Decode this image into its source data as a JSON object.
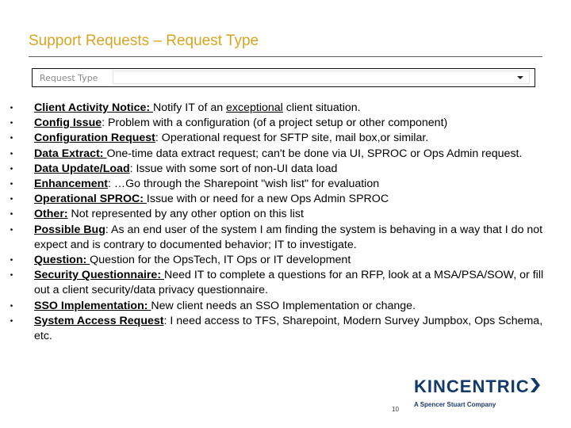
{
  "slide": {
    "title": "Support Requests – Request Type",
    "page_number": "10"
  },
  "request_type_field": {
    "label": "Request Type",
    "value": "",
    "icon": "caret-down-icon"
  },
  "bullet_glyph": "•",
  "items": [
    {
      "term": "Client Activity Notice: ",
      "parts": [
        {
          "text": "Notify IT of an ",
          "u": false
        },
        {
          "text": "exceptional",
          "u": true
        },
        {
          "text": " client situation.",
          "u": false
        }
      ]
    },
    {
      "term": "Config Issue",
      "parts": [
        {
          "text": ": Problem with a configuration (of a project setup or other component)",
          "u": false
        }
      ]
    },
    {
      "term": "Configuration Request",
      "parts": [
        {
          "text": ": Operational request for SFTP site, mail box,or similar.",
          "u": false
        }
      ]
    },
    {
      "term": "Data Extract: ",
      "parts": [
        {
          "text": "One-time data extract request; can't be done via UI, SPROC or Ops Admin request.",
          "u": false
        }
      ]
    },
    {
      "term": "Data Update/Load",
      "parts": [
        {
          "text": ": Issue with some sort of non-UI data load",
          "u": false
        }
      ]
    },
    {
      "term": "Enhancement",
      "parts": [
        {
          "text": ": …Go through the Sharepoint \"wish list\" for evaluation",
          "u": false
        }
      ]
    },
    {
      "term": "Operational SPROC: ",
      "parts": [
        {
          "text": "Issue with or need for a new Ops Admin SPROC",
          "u": false
        }
      ]
    },
    {
      "term": "Other:",
      "parts": [
        {
          "text": " Not represented by any other option on this list",
          "u": false
        }
      ]
    },
    {
      "term": "Possible Bug",
      "parts": [
        {
          "text": ": As an end user of the system I am finding the system is behaving in a way that I do not expect and is contrary to documented behavior; IT to investigate.",
          "u": false
        }
      ]
    },
    {
      "term": "Question: ",
      "parts": [
        {
          "text": "Question for the OpsTech, IT Ops or IT development",
          "u": false
        }
      ]
    },
    {
      "term": "Security Questionnaire: ",
      "parts": [
        {
          "text": "Need IT to complete a questions for an RFP, look at a MSA/PSA/SOW, or fill out a client security/data privacy questionnaire.",
          "u": false
        }
      ]
    },
    {
      "term": "SSO Implementation: ",
      "parts": [
        {
          "text": "New client needs an SSO Implementation or change.",
          "u": false
        }
      ]
    },
    {
      "term": "System Access Request",
      "parts": [
        {
          "text": ": I need access to TFS, Sharepoint, Modern Survey Jumpbox, Ops Schema, etc.",
          "u": false
        }
      ]
    }
  ],
  "logo": {
    "wordmark": "KINCENTRIC",
    "tagline": "A Spencer Stuart Company",
    "brand_color": "#133a6b"
  },
  "colors": {
    "title": "#d9a521",
    "divider": "#5a5a5a"
  }
}
